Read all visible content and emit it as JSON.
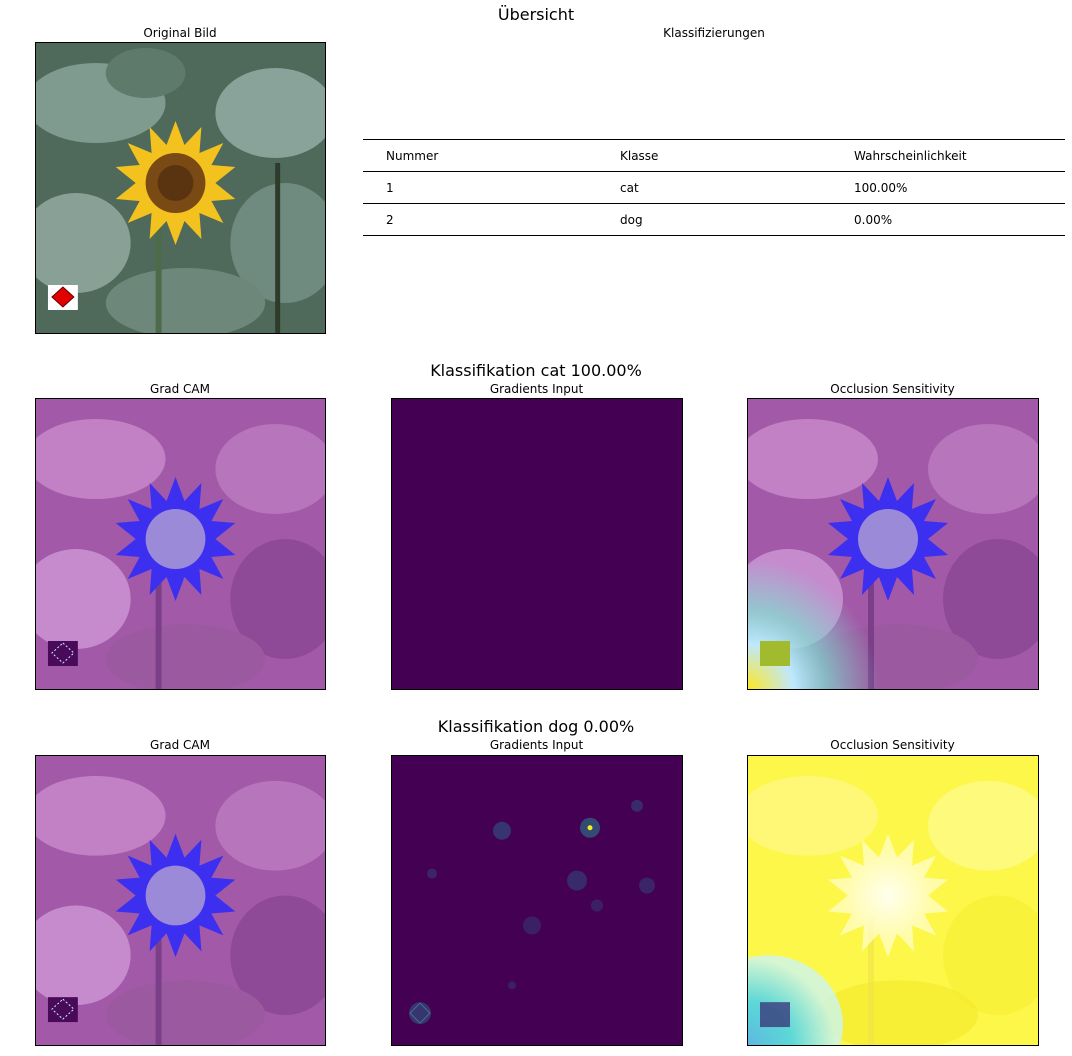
{
  "overview": {
    "title": "Übersicht",
    "original_title": "Original Bild",
    "classifications_title": "Klassifizierungen",
    "table": {
      "headers": [
        "Nummer",
        "Klasse",
        "Wahrscheinlichkeit"
      ],
      "rows": [
        [
          "1",
          "cat",
          "100.00%"
        ],
        [
          "2",
          "dog",
          "0.00%"
        ]
      ]
    }
  },
  "sections": [
    {
      "title": "Klassifikation cat 100.00%",
      "panels": [
        "Grad CAM",
        "Gradients Input",
        "Occlusion Sensitivity"
      ]
    },
    {
      "title": "Klassifikation dog 0.00%",
      "panels": [
        "Grad CAM",
        "Gradients Input",
        "Occlusion Sensitivity"
      ]
    }
  ],
  "colors": {
    "viridis_dark": "#440154",
    "gradcam_purple": "#a25aa8",
    "flower_blue": "#3d2ff0",
    "sunflower_yellow": "#f4c21e",
    "occlusion_yellow": "#fdf74a"
  }
}
